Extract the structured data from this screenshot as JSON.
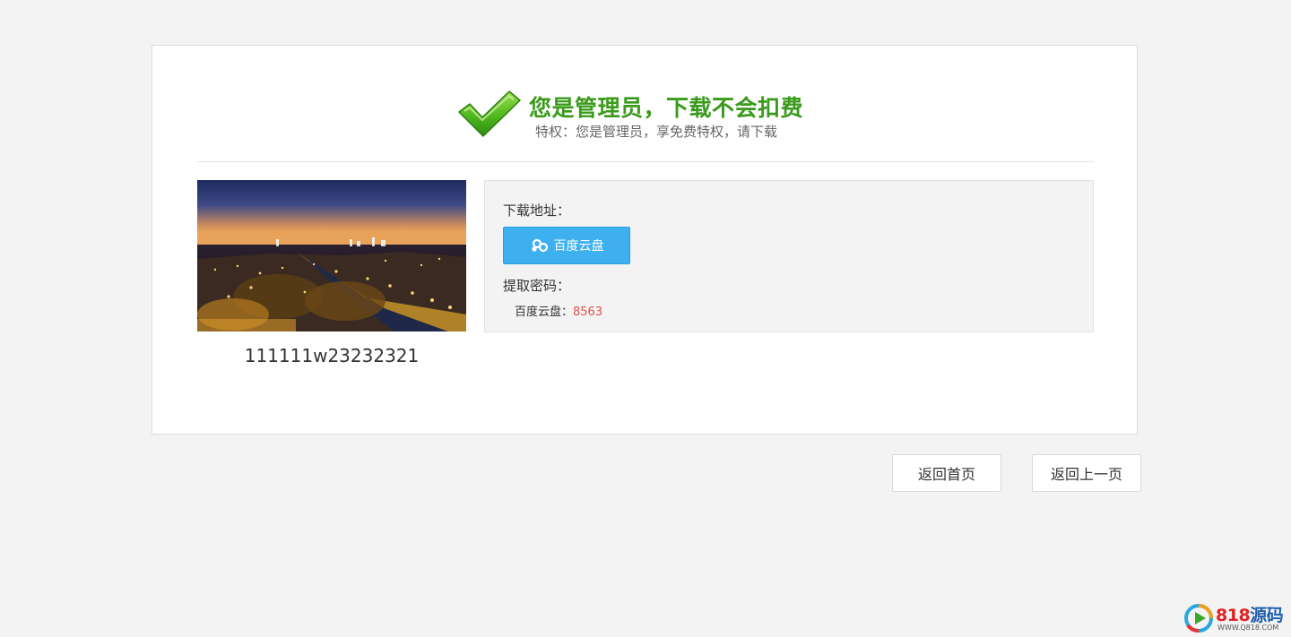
{
  "header": {
    "title": "您是管理员，下载不会扣费",
    "subtitle": "特权：您是管理员，享免费特权，请下载"
  },
  "resource": {
    "name": "111111w23232321",
    "thumbnail_icon": "night-city-thumbnail"
  },
  "download": {
    "address_label": "下载地址：",
    "baidu_button_label": "百度云盘",
    "password_label": "提取密码：",
    "password_source": "百度云盘：",
    "password_code": "8563"
  },
  "nav": {
    "home_label": "返回首页",
    "back_label": "返回上一页"
  },
  "watermark": {
    "brand_num": "818",
    "brand_cn": "源码",
    "url": "WWW.Q818.COM"
  },
  "colors": {
    "title_green": "#3a9a1c",
    "button_blue": "#3eb0f0",
    "code_red": "#d9534f",
    "background": "#f3f3f3"
  }
}
